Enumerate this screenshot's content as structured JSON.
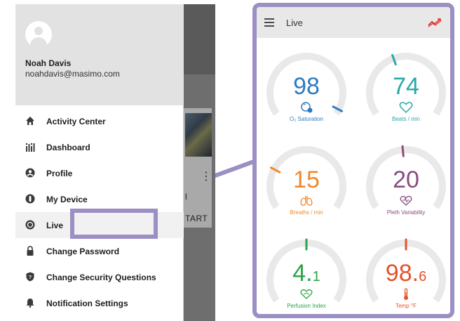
{
  "drawer": {
    "user_name": "Noah Davis",
    "user_email": "noahdavis@masimo.com",
    "items": [
      {
        "label": "Activity Center",
        "icon": "home-icon"
      },
      {
        "label": "Dashboard",
        "icon": "dashboard-icon"
      },
      {
        "label": "Profile",
        "icon": "profile-icon"
      },
      {
        "label": "My Device",
        "icon": "device-icon"
      },
      {
        "label": "Live",
        "icon": "live-icon"
      },
      {
        "label": "Change Password",
        "icon": "lock-icon"
      },
      {
        "label": "Change Security Questions",
        "icon": "shield-question-icon"
      },
      {
        "label": "Notification Settings",
        "icon": "bell-icon"
      }
    ]
  },
  "background": {
    "card_text_1": "l",
    "card_text_2": "TART"
  },
  "live": {
    "title": "Live",
    "gauges": [
      {
        "value": "98",
        "label": "O₂ Saturation",
        "color": "#2e7bbf",
        "icon": "oxygen-icon",
        "level": 0.97
      },
      {
        "value": "74",
        "label": "Beats / min",
        "color": "#27a8a8",
        "icon": "heart-icon",
        "level": 0.42
      },
      {
        "value": "15",
        "label": "Breaths / min",
        "color": "#f0892b",
        "icon": "lungs-icon",
        "level": 0.25
      },
      {
        "value": "20",
        "label": "Pleth Variability",
        "color": "#8a4c7f",
        "icon": "pleth-heart-icon",
        "level": 0.48
      },
      {
        "value": "4.",
        "value_small": "1",
        "label": "Perfusion Index",
        "color": "#2aa345",
        "icon": "perfusion-heart-icon",
        "level": 0.5
      },
      {
        "value": "98.",
        "value_small": "6",
        "label": "Temp °F",
        "color": "#e5532b",
        "icon": "thermometer-icon",
        "level": 0.5
      }
    ]
  },
  "colors": {
    "highlight": "#9c8fc4",
    "trend_icon": "#e0302a"
  }
}
